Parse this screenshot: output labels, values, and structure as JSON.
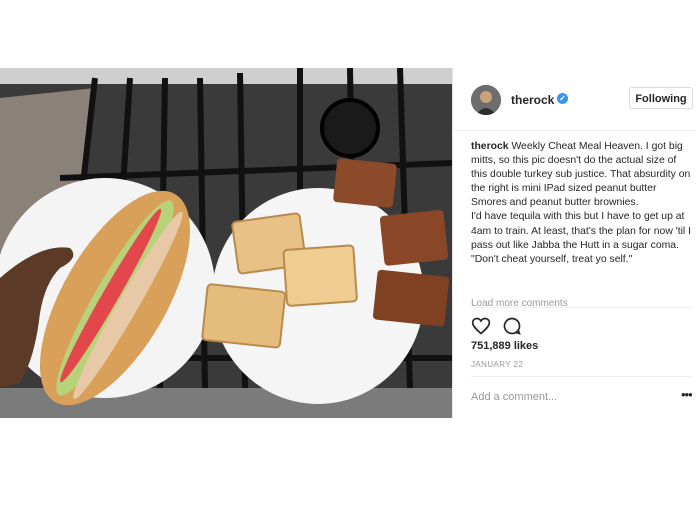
{
  "post": {
    "username": "therock",
    "follow_label": "Following",
    "caption_user": "therock",
    "caption_1": "Weekly Cheat Meal Heaven. I got big mitts, so this pic doesn't do the actual size of this double turkey sub justice. That absurdity on the right is mini IPad sized peanut butter Smores and peanut butter brownies.",
    "caption_2": "I'd have tequila with this but I have to get up at 4am to train. At least, that's the plan for now 'til I pass out like Jabba the Hutt in a sugar coma. \"Don't cheat yourself, treat yo self.\"",
    "load_more": "Load more comments",
    "likes": "751,889 likes",
    "date": "JANUARY 22",
    "comment_placeholder": "Add a comment...",
    "more_label": "•••"
  },
  "icons": [
    "verified-badge-icon",
    "heart-icon",
    "comment-icon",
    "more-options-icon"
  ],
  "colors": {
    "verified": "#3897f0",
    "text": "#262626",
    "muted": "#999999"
  }
}
